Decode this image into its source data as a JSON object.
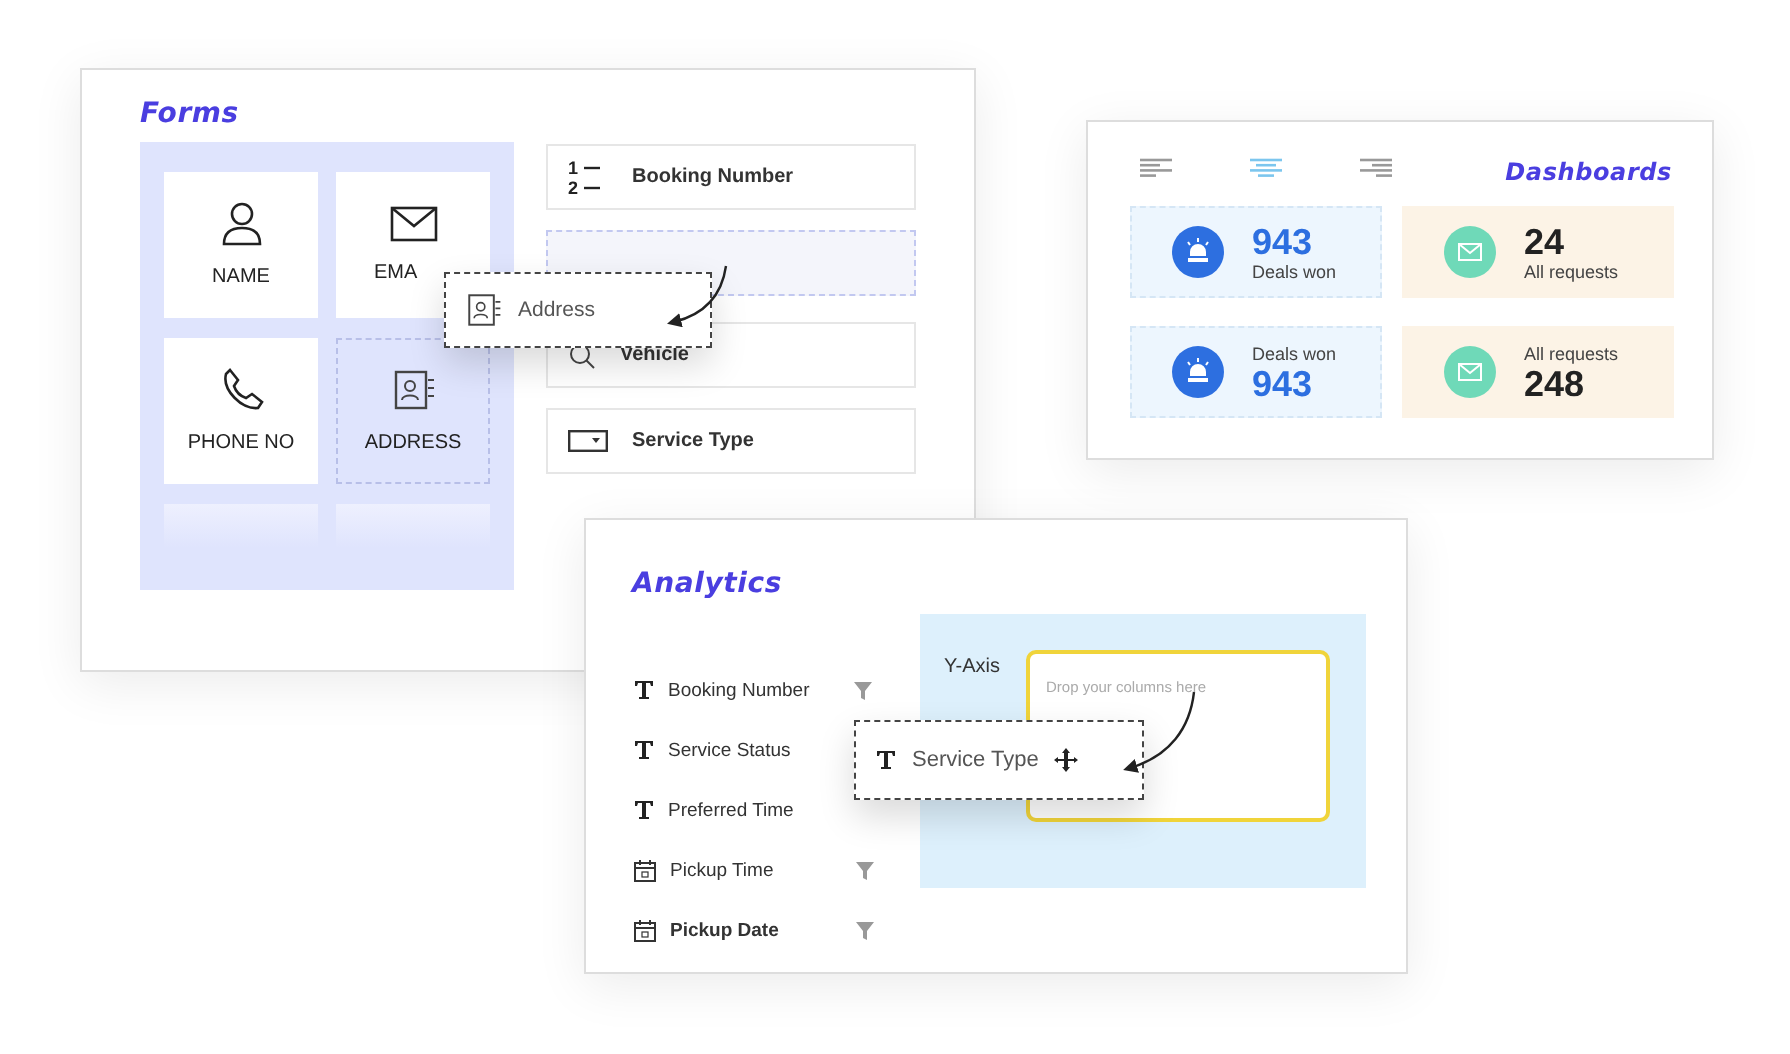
{
  "forms": {
    "title": "Forms",
    "tiles": [
      {
        "kind": "person",
        "label": "NAME",
        "dashed": false
      },
      {
        "kind": "mail",
        "label": "EMA",
        "dashed": false
      },
      {
        "kind": "phone",
        "label": "PHONE NO",
        "dashed": false
      },
      {
        "kind": "contact",
        "label": "ADDRESS",
        "dashed": true
      }
    ],
    "fields": [
      {
        "kind": "numbered",
        "label": "Booking Number",
        "numbers": [
          "1",
          "2"
        ]
      },
      {
        "kind": "dropzone"
      },
      {
        "kind": "search",
        "label": "Vehicle"
      },
      {
        "kind": "dropdown",
        "label": "Service Type"
      }
    ],
    "dragged": {
      "label": "Address"
    }
  },
  "dashboards": {
    "title": "Dashboards",
    "align": [
      {
        "kind": "left",
        "selected": false
      },
      {
        "kind": "center",
        "selected": true
      },
      {
        "kind": "right",
        "selected": false
      }
    ],
    "stats": [
      {
        "kind": "deals",
        "value": "943",
        "label": "Deals won",
        "value_first": true
      },
      {
        "kind": "requests",
        "value": "24",
        "label": "All requests",
        "value_first": true
      },
      {
        "kind": "deals",
        "value": "943",
        "label": "Deals won",
        "value_first": false
      },
      {
        "kind": "requests",
        "value": "248",
        "label": "All requests",
        "value_first": false
      }
    ]
  },
  "analytics": {
    "title": "Analytics",
    "columns": [
      {
        "kind": "text",
        "label": "Booking Number",
        "bold": false
      },
      {
        "kind": "text",
        "label": "Service Status",
        "bold": false
      },
      {
        "kind": "text",
        "label": "Preferred Time",
        "bold": false
      },
      {
        "kind": "date",
        "label": "Pickup Time",
        "bold": false
      },
      {
        "kind": "date",
        "label": "Pickup Date",
        "bold": true
      }
    ],
    "axis_label": "Y-Axis",
    "drop_placeholder": "Drop your columns here",
    "dragged": {
      "label": "Service Type"
    }
  }
}
